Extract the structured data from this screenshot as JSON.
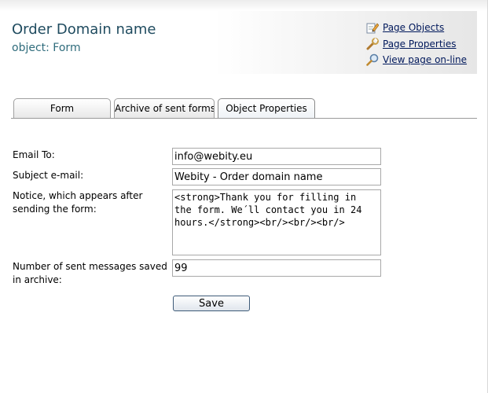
{
  "header": {
    "title": "Order Domain name",
    "subtitle": "object: Form",
    "links": [
      {
        "label": "Page Objects",
        "icon": "pencil-icon"
      },
      {
        "label": "Page Properties",
        "icon": "wrench-icon"
      },
      {
        "label": "View page on-line",
        "icon": "magnifier-icon"
      }
    ]
  },
  "tabs": [
    {
      "label": "Form"
    },
    {
      "label": "Archive of sent forms"
    },
    {
      "label": "Object Properties",
      "active": true
    }
  ],
  "form": {
    "email_to": {
      "label": "Email To:",
      "value": "info@webity.eu"
    },
    "subject": {
      "label": "Subject e-mail:",
      "value": "Webity - Order domain name"
    },
    "notice": {
      "label": "Notice, which appears after sending the form:",
      "value": "<strong>Thank you for filling in the form. We´ll contact you in 24 hours.</strong><br/><br/><br/>"
    },
    "archive_count": {
      "label": "Number of sent messages saved in archive:",
      "value": "99"
    },
    "save_label": "Save"
  },
  "colors": {
    "title": "#1f4b5f",
    "link": "#00185b"
  }
}
